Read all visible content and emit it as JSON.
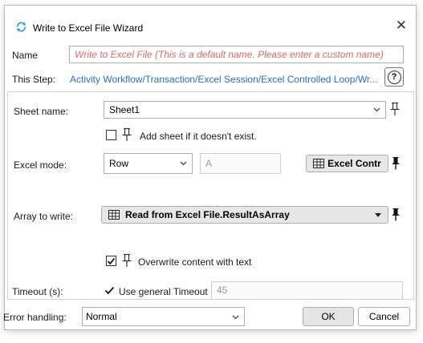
{
  "window": {
    "title": "Write to Excel File Wizard",
    "close_symbol": "✕"
  },
  "header": {
    "name_label": "Name",
    "name_value": "Write to Excel File  (This is a default name. Please enter a custom name)",
    "step_label": "This Step:",
    "step_path": "Activity Workflow/Transaction/Excel Session/Excel Controlled Loop/Wr...",
    "help_symbol": "?"
  },
  "form": {
    "sheet_name_label": "Sheet name:",
    "sheet_name_value": "Sheet1",
    "add_sheet_label": "Add sheet if it doesn't exist.",
    "add_sheet_checked": false,
    "excel_mode_label": "Excel mode:",
    "excel_mode_value": "Row",
    "excel_mode_field": "A",
    "excel_control_label": "Excel Contr",
    "array_label": "Array to write:",
    "array_value": "Read from Excel File.ResultAsArray",
    "overwrite_label": "Overwrite content with text",
    "overwrite_checked": true,
    "timeout_label": "Timeout (s):",
    "general_timeout_label": "Use general Timeout",
    "general_timeout_checked": true,
    "timeout_value": "45"
  },
  "footer": {
    "error_handling_label": "Error handling:",
    "error_handling_value": "Normal",
    "ok_label": "OK",
    "cancel_label": "Cancel"
  },
  "icons": {
    "app": "sync-arrows-icon",
    "pin": "pin-icon",
    "table": "table-grid-icon"
  },
  "colors": {
    "link": "#2a6fcc",
    "placeholder_red": "#e06a6a",
    "app_icon": "#3aa0d8"
  }
}
